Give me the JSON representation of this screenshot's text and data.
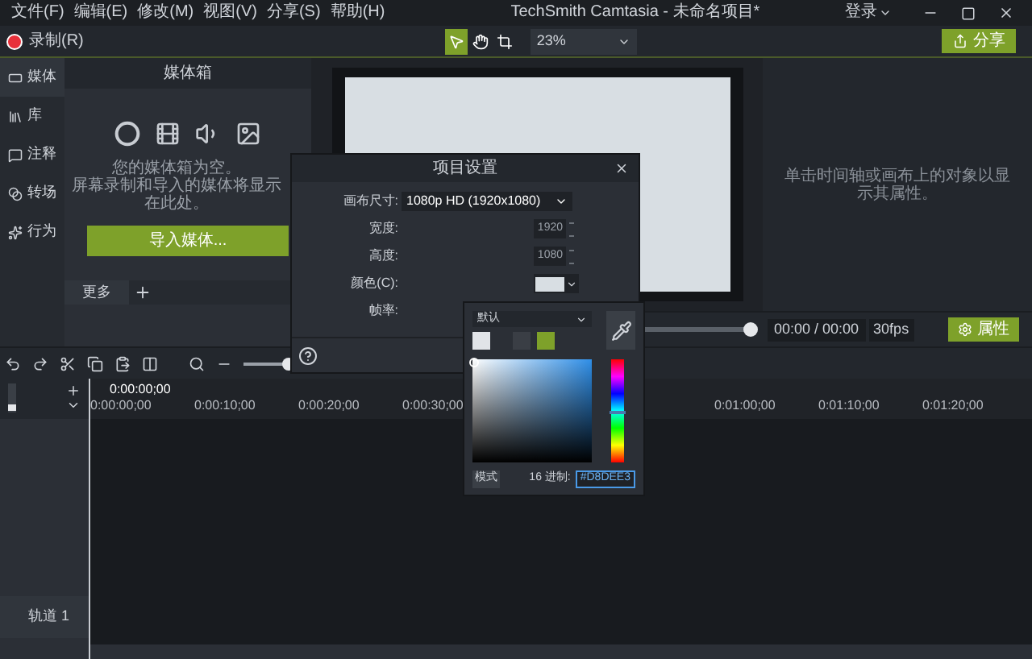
{
  "menu_bar": {
    "items": [
      "文件(F)",
      "编辑(E)",
      "修改(M)",
      "视图(V)",
      "分享(S)",
      "帮助(H)"
    ],
    "title": "TechSmith Camtasia - 未命名项目*",
    "login": "登录"
  },
  "toolbar": {
    "record": "录制(R)",
    "tools": [
      {
        "kind": "pointer",
        "selected": true
      },
      {
        "kind": "hand",
        "selected": false
      },
      {
        "kind": "crop",
        "selected": false
      }
    ],
    "zoom": "23%",
    "share": "分享"
  },
  "sidebar": {
    "items": [
      {
        "kind": "media",
        "label": "媒体",
        "selected": true
      },
      {
        "kind": "library",
        "label": "库",
        "selected": false
      },
      {
        "kind": "annotations",
        "label": "注释",
        "selected": false
      },
      {
        "kind": "transitions",
        "label": "转场",
        "selected": false
      },
      {
        "kind": "behaviors",
        "label": "行为",
        "selected": false
      }
    ],
    "more": "更多"
  },
  "media_bin": {
    "title": "媒体箱",
    "empty_lines": [
      "您的媒体箱为空。",
      "屏幕录制和导入的媒体将显示在此处。"
    ],
    "import_button": "导入媒体..."
  },
  "properties": {
    "hint": "单击时间轴或画布上的对象以显示其属性。",
    "button": "属性"
  },
  "playback": {
    "level": 1,
    "time": "00:00 / 00:00",
    "fps": "30fps"
  },
  "timeline": {
    "zoom": {
      "level": 0.55
    },
    "track_height": {
      "level": 0.1
    },
    "playhead_time": "0:00:00;00",
    "ruler_labels": [
      "0:00:00;00",
      "0:00:10;00",
      "0:00:20;00",
      "0:00:30;00",
      "0:01:00;00",
      "0:01:10;00",
      "0:01:20;00"
    ],
    "tracks": [
      {
        "name": "轨道 1"
      }
    ]
  },
  "dialog": {
    "title": "项目设置",
    "fields": [
      {
        "kind": "select",
        "label": "画布尺寸:",
        "value": "1080p HD (1920x1080)"
      },
      {
        "kind": "spinner",
        "label": "宽度:",
        "value": "1920"
      },
      {
        "kind": "spinner",
        "label": "高度:",
        "value": "1080"
      },
      {
        "kind": "color",
        "label": "颜色(C):",
        "color": "#d8dee3"
      },
      {
        "kind": "hidden",
        "label": "帧率:"
      }
    ]
  },
  "color_picker": {
    "preset": "默认",
    "swatches": [
      {
        "color": "#e1e4e8"
      },
      {
        "color": "#3a3e45"
      },
      {
        "color": "#7ea12a"
      }
    ],
    "hue": {
      "level": 0.5
    },
    "mode_button": "模式",
    "hex_label": "16 进制:",
    "hex_value": "#D8DEE3"
  }
}
